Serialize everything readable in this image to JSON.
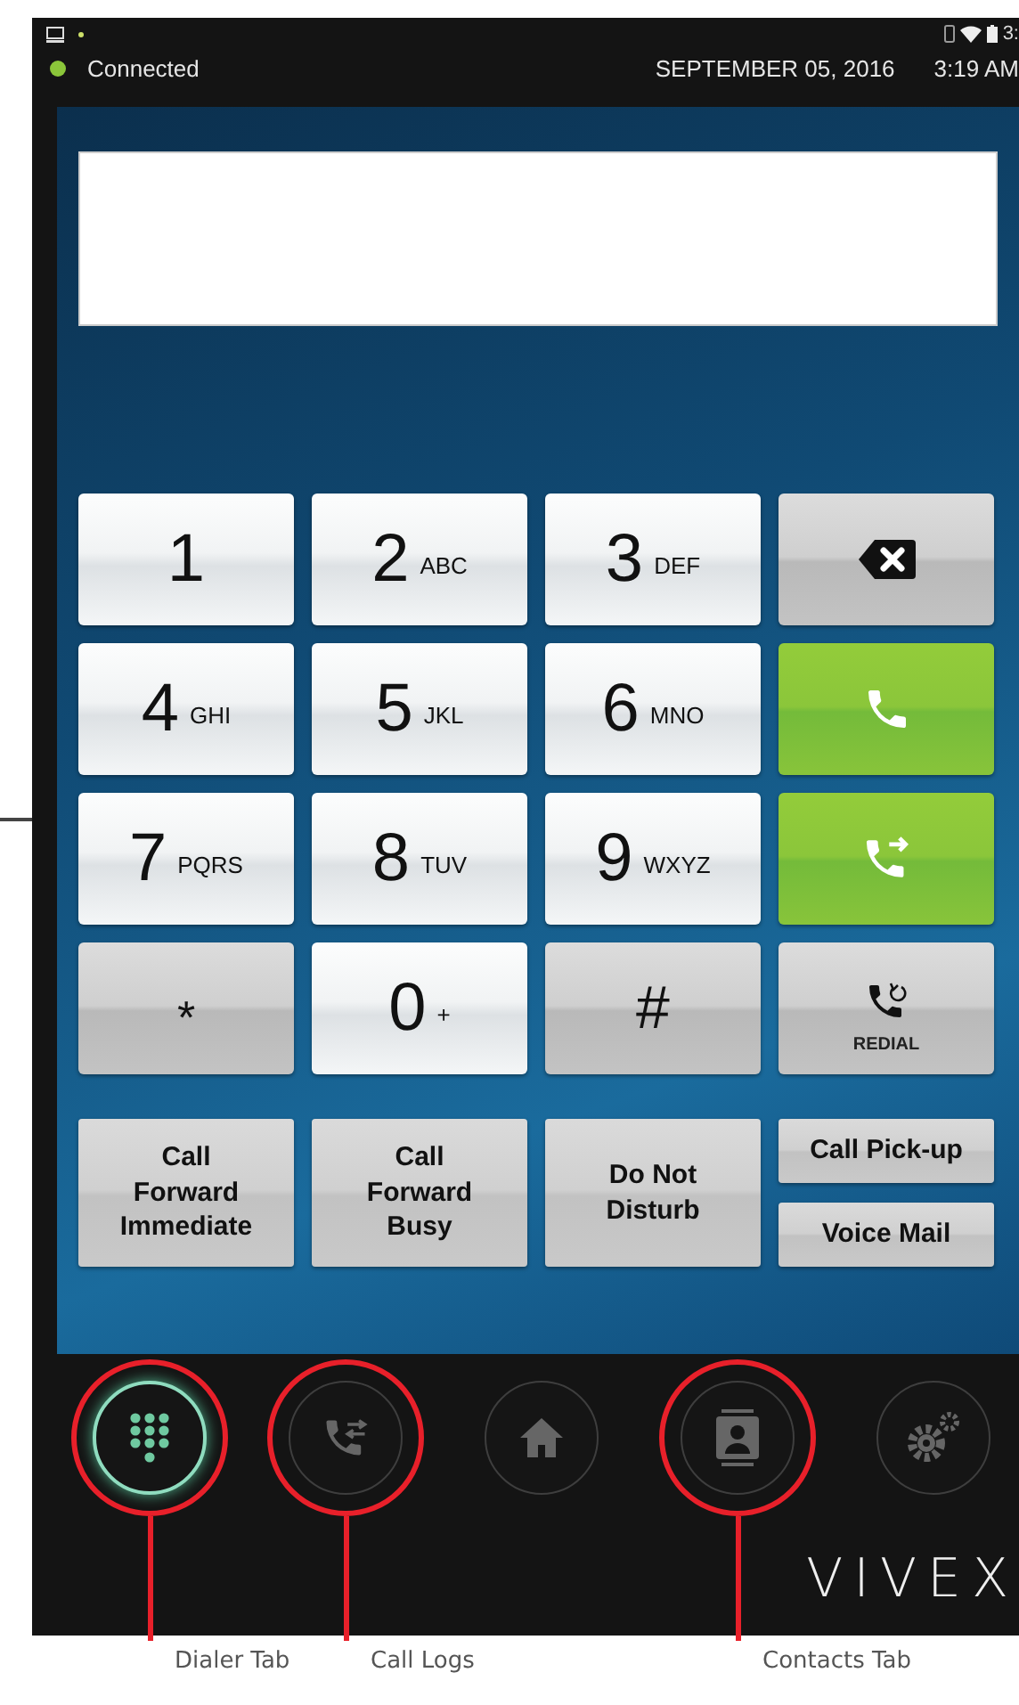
{
  "status_bar": {
    "clock_partial": "3:",
    "connected": true,
    "status": "Connected",
    "date": "SEPTEMBER 05, 2016",
    "time": "3:19 AM"
  },
  "keypad": [
    {
      "kind": "digit",
      "digit": "1"
    },
    {
      "kind": "digit",
      "digit": "2",
      "letters": "ABC"
    },
    {
      "kind": "digit",
      "digit": "3",
      "letters": "DEF"
    },
    {
      "kind": "delete"
    },
    {
      "kind": "digit",
      "digit": "4",
      "letters": "GHI"
    },
    {
      "kind": "digit",
      "digit": "5",
      "letters": "JKL"
    },
    {
      "kind": "digit",
      "digit": "6",
      "letters": "MNO"
    },
    {
      "kind": "call"
    },
    {
      "kind": "digit",
      "digit": "7",
      "letters": "PQRS"
    },
    {
      "kind": "digit",
      "digit": "8",
      "letters": "TUV"
    },
    {
      "kind": "digit",
      "digit": "9",
      "letters": "WXYZ"
    },
    {
      "kind": "transfer"
    },
    {
      "kind": "symbol",
      "digit": "*"
    },
    {
      "kind": "digit",
      "digit": "0",
      "letters": "+"
    },
    {
      "kind": "symbol",
      "digit": "#"
    },
    {
      "kind": "redial",
      "label": "REDIAL"
    }
  ],
  "function_buttons": [
    {
      "label": "Call Forward Immediate"
    },
    {
      "label": "Call Forward Busy"
    },
    {
      "label": "Do Not Disturb"
    }
  ],
  "side_buttons": [
    {
      "label": "Call Pick-up"
    },
    {
      "label": "Voice Mail"
    }
  ],
  "nav": [
    {
      "kind": "dialer",
      "selected": true,
      "callout": "Dialer Tab"
    },
    {
      "kind": "logs",
      "selected": false,
      "callout": "Call Logs"
    },
    {
      "kind": "home",
      "selected": false
    },
    {
      "kind": "contacts",
      "selected": false,
      "callout": "Contacts Tab"
    },
    {
      "kind": "settings",
      "selected": false
    }
  ],
  "logo": "VIVEX"
}
